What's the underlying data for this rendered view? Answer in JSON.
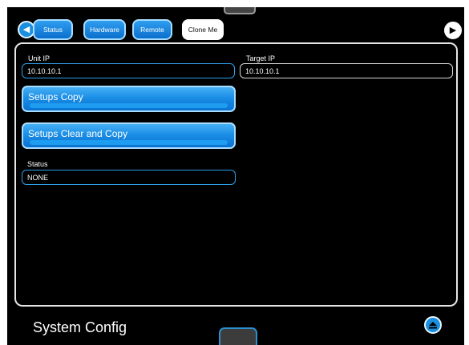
{
  "tabs": [
    {
      "label": "Status"
    },
    {
      "label": "Hardware"
    },
    {
      "label": "Remote"
    },
    {
      "label": "Clone Me"
    }
  ],
  "form": {
    "unit_ip_label": "Unit IP",
    "unit_ip_value": "10.10.10.1",
    "target_ip_label": "Target IP",
    "target_ip_value": "10.10.10.1",
    "setups_copy_label": "Setups Copy",
    "setups_clear_copy_label": "Setups Clear and Copy",
    "status_label": "Status",
    "status_value": "NONE"
  },
  "footer": {
    "title": "System Config"
  },
  "icons": {
    "back": "arrow-left-icon",
    "forward": "arrow-right-icon",
    "eject": "eject-icon"
  },
  "colors": {
    "accent": "#1a8fe0",
    "background": "#000000",
    "text": "#ffffff"
  }
}
